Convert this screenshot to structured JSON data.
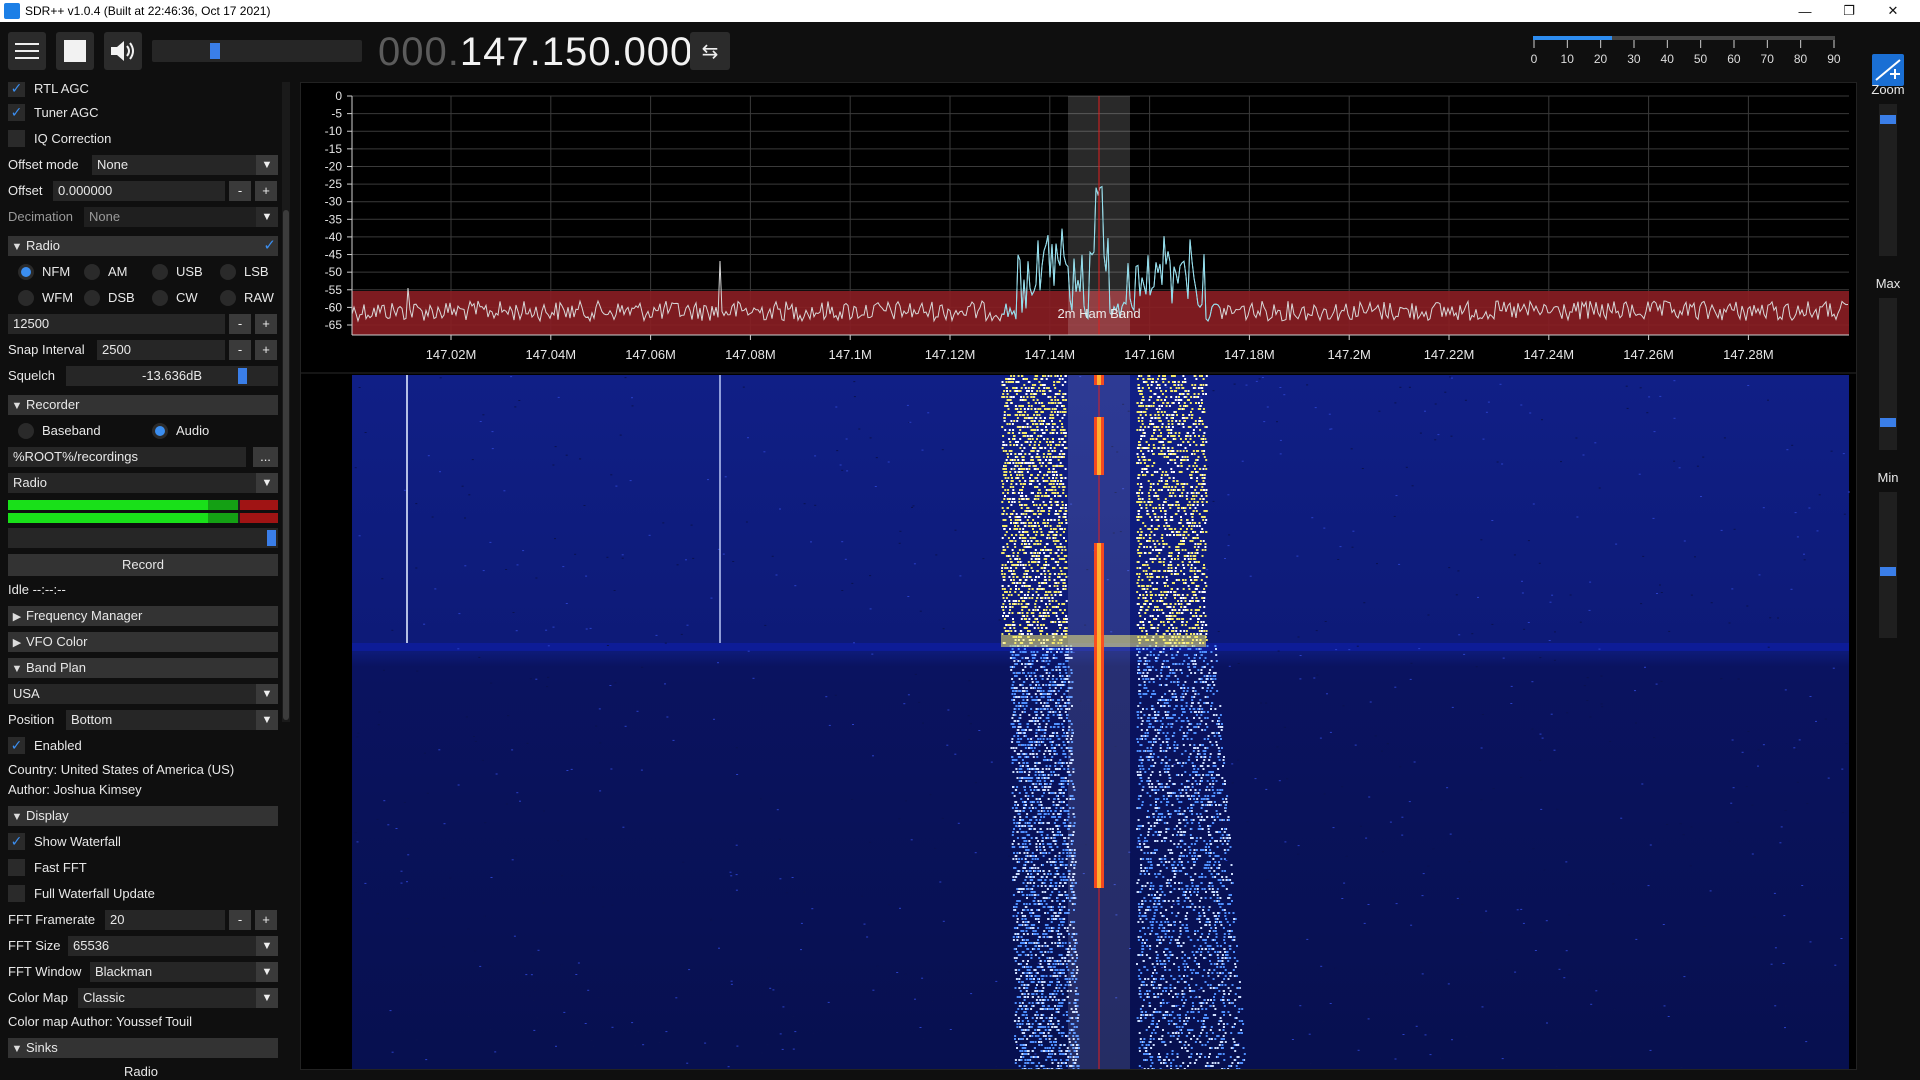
{
  "window": {
    "title": "SDR++ v1.0.4 (Built at 22:46:36, Oct 17 2021)",
    "minimize": "—",
    "maximize": "❐",
    "close": "✕"
  },
  "toolbar": {
    "freq_dim": "000.",
    "freq_bright": "147.150.000",
    "swap_icon": "⇆",
    "volume_level": 0.29,
    "snr_ticks": [
      "0",
      "10",
      "20",
      "30",
      "40",
      "50",
      "60",
      "70",
      "80",
      "90"
    ],
    "snr_level": 0.26
  },
  "left": {
    "rtl_agc": "RTL AGC",
    "tuner_agc": "Tuner AGC",
    "iq_correction": "IQ Correction",
    "offset_mode_label": "Offset mode",
    "offset_mode_value": "None",
    "offset_label": "Offset",
    "offset_value": "0.000000",
    "decimation_label": "Decimation",
    "decimation_value": "None",
    "radio_header": "Radio",
    "modes": [
      "NFM",
      "AM",
      "USB",
      "LSB",
      "WFM",
      "DSB",
      "CW",
      "RAW"
    ],
    "bandwidth_value": "12500",
    "snap_label": "Snap Interval",
    "snap_value": "2500",
    "squelch_label": "Squelch",
    "squelch_value": "-13.636dB",
    "recorder_header": "Recorder",
    "baseband": "Baseband",
    "audio": "Audio",
    "rec_path": "%ROOT%/recordings",
    "rec_browse": "...",
    "rec_source": "Radio",
    "record_button": "Record",
    "rec_status": "Idle --:--:--",
    "freq_manager_header": "Frequency Manager",
    "vfo_color_header": "VFO Color",
    "band_plan_header": "Band Plan",
    "band_plan_value": "USA",
    "position_label": "Position",
    "position_value": "Bottom",
    "enabled": "Enabled",
    "country": "Country: United States of America (US)",
    "author": "Author: Joshua Kimsey",
    "display_header": "Display",
    "show_waterfall": "Show Waterfall",
    "fast_fft": "Fast FFT",
    "full_waterfall": "Full Waterfall Update",
    "fft_framerate_label": "FFT Framerate",
    "fft_framerate_value": "20",
    "fft_size_label": "FFT Size",
    "fft_size_value": "65536",
    "fft_window_label": "FFT Window",
    "fft_window_value": "Blackman",
    "color_map_label": "Color Map",
    "color_map_value": "Classic",
    "color_map_author": "Color map Author: Youssef Touil",
    "sinks_header": "Sinks",
    "sinks_first": "Radio",
    "minus": "-",
    "plus": "+",
    "checkmark": "✓"
  },
  "spectrum": {
    "y_ticks": [
      "0",
      "-5",
      "-10",
      "-15",
      "-20",
      "-25",
      "-30",
      "-35",
      "-40",
      "-45",
      "-50",
      "-55",
      "-60",
      "-65"
    ],
    "x_ticks": [
      "147.02M",
      "147.04M",
      "147.06M",
      "147.08M",
      "147.1M",
      "147.12M",
      "147.14M",
      "147.16M",
      "147.18M",
      "147.2M",
      "147.22M",
      "147.24M",
      "147.26M",
      "147.28M"
    ],
    "band_label": "2m Ham Band",
    "colors": {
      "band": "#8b1e24",
      "trace": "#cfcfcf",
      "signal": "#7fd3e6",
      "vfo": "#e02020",
      "waterfall_bg": "#0a1a6e"
    }
  },
  "right": {
    "zoom": "Zoom",
    "max": "Max",
    "min": "Min",
    "zoom_level": 0.08,
    "max_level": 0.84,
    "min_level": 0.55
  }
}
